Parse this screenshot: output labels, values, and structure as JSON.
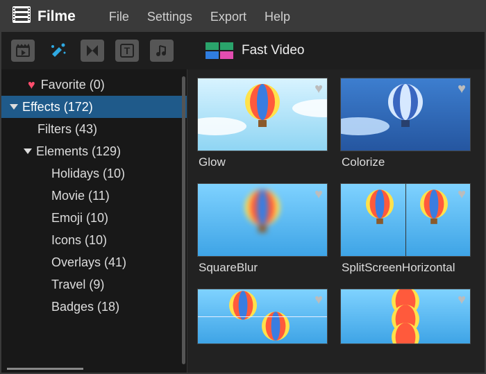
{
  "app": {
    "name": "Filme"
  },
  "menu": {
    "file": "File",
    "settings": "Settings",
    "export": "Export",
    "help": "Help"
  },
  "toolbar": {
    "fast_video": "Fast Video"
  },
  "sidebar": {
    "favorite": "Favorite (0)",
    "effects": "Effects (172)",
    "filters": "Filters (43)",
    "elements": "Elements (129)",
    "holidays": "Holidays (10)",
    "movie": "Movie (11)",
    "emoji": "Emoji (10)",
    "icons": "Icons (10)",
    "overlays": "Overlays (41)",
    "travel": "Travel (9)",
    "badges": "Badges (18)"
  },
  "gallery": {
    "glow": "Glow",
    "colorize": "Colorize",
    "squareblur": "SquareBlur",
    "splitscreen": "SplitScreenHorizontal"
  }
}
